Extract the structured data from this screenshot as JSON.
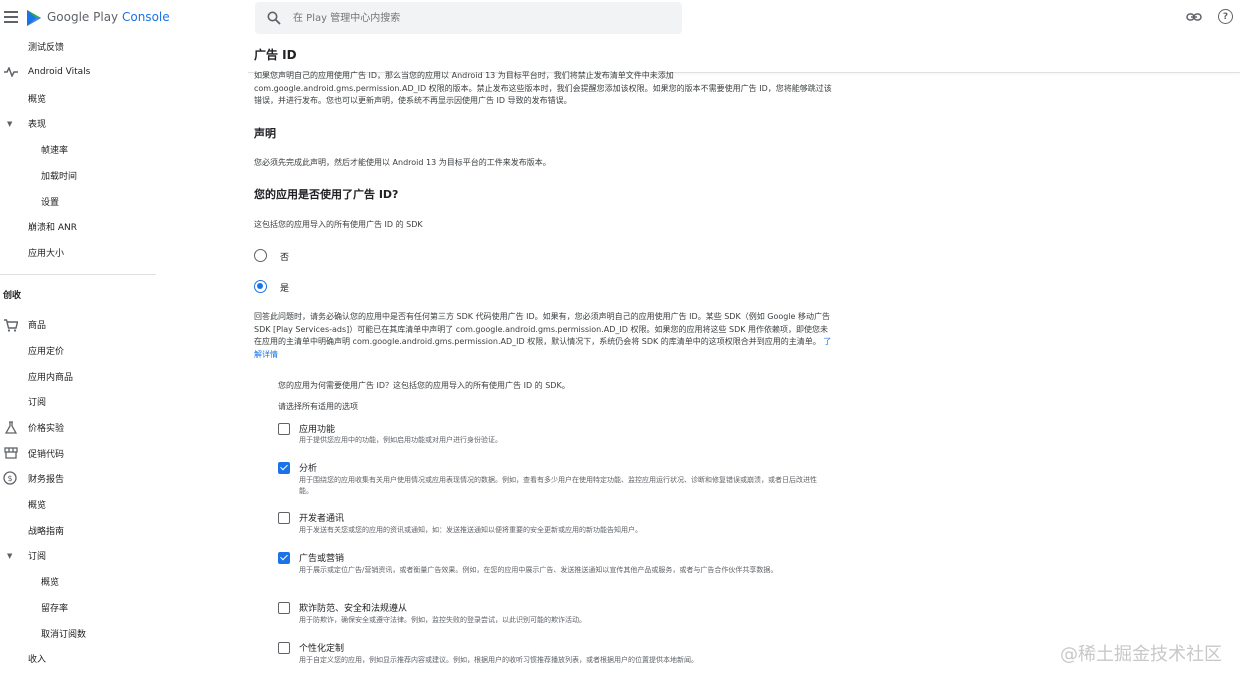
{
  "app": {
    "brand_prefix": "Google Play",
    "brand_suffix": "Console"
  },
  "search": {
    "placeholder": "在 Play 管理中心内搜索"
  },
  "sidebar": {
    "items": [
      {
        "label": "测试反馈"
      },
      {
        "label": "Android Vitals"
      },
      {
        "label": "概览"
      },
      {
        "label": "表现"
      },
      {
        "label": "帧速率"
      },
      {
        "label": "加载时间"
      },
      {
        "label": "设置"
      },
      {
        "label": "崩溃和 ANR"
      },
      {
        "label": "应用大小"
      },
      {
        "label": "创收"
      },
      {
        "label": "商品"
      },
      {
        "label": "应用定价"
      },
      {
        "label": "应用内商品"
      },
      {
        "label": "订阅"
      },
      {
        "label": "价格实验"
      },
      {
        "label": "促销代码"
      },
      {
        "label": "财务报告"
      },
      {
        "label": "概览"
      },
      {
        "label": "战略指南"
      },
      {
        "label": "订阅"
      },
      {
        "label": "概览"
      },
      {
        "label": "留存率"
      },
      {
        "label": "取消订阅数"
      },
      {
        "label": "收入"
      }
    ]
  },
  "main": {
    "title": "广告 ID",
    "intro": "如果您声明自己的应用使用广告 ID，那么当您的应用以 Android 13 为目标平台时，我们将禁止发布清单文件中未添加 com.google.android.gms.permission.AD_ID 权限的版本。禁止发布这些版本时，我们会提醒您添加该权限。如果您的版本不需要使用广告 ID，您将能够跳过该错误，并进行发布。您也可以更新声明，使系统不再显示因使用广告 ID 导致的发布错误。",
    "declaration_heading": "声明",
    "declaration_text": "您必须先完成此声明，然后才能使用以 Android 13 为目标平台的工件来发布版本。",
    "question": "您的应用是否使用了广告 ID?",
    "question_sub": "这包括您的应用导入的所有使用广告 ID 的 SDK",
    "radio_no": "否",
    "radio_yes": "是",
    "explain": "回答此问题时，请务必确认您的应用中是否有任何第三方 SDK 代码使用广告 ID。如果有，您必须声明自己的应用使用广告 ID。某些 SDK（例如 Google 移动广告 SDK [Play Services-ads]）可能已在其库清单中声明了 com.google.android.gms.permission.AD_ID 权限。如果您的应用将这些 SDK 用作依赖项，即使您未在应用的主清单中明确声明 com.google.android.gms.permission.AD_ID 权限，默认情况下，系统仍会将 SDK 的库清单中的这项权限合并到应用的主清单。",
    "learn_more": "了解详情",
    "why_question": "您的应用为何需要使用广告 ID？这包括您的应用导入的所有使用广告 ID 的 SDK。",
    "select_all": "请选择所有适用的选项",
    "options": [
      {
        "title": "应用功能",
        "desc": "用于提供您应用中的功能，例如启用功能或对用户进行身份验证。",
        "checked": false
      },
      {
        "title": "分析",
        "desc": "用于围绕您的应用收集有关用户使用情况或应用表现情况的数据。例如，查看有多少用户在使用特定功能、监控应用运行状况、诊断和修复错误或崩溃，或者日后改进性能。",
        "checked": true
      },
      {
        "title": "开发者通讯",
        "desc": "用于发送有关您或您的应用的资讯或通知，如：发送推送通知以便将重要的安全更新或应用的新功能告知用户。",
        "checked": false
      },
      {
        "title": "广告或营销",
        "desc": "用于展示或定位广告/营销资讯，或者衡量广告效果。例如，在您的应用中展示广告、发送推送通知以宣传其他产品或服务，或者与广告合作伙伴共享数据。",
        "checked": true
      },
      {
        "title": "欺诈防范、安全和法规遵从",
        "desc": "用于防欺诈，确保安全或遵守法律。例如，监控失败的登录尝试，以此识别可能的欺诈活动。",
        "checked": false
      },
      {
        "title": "个性化定制",
        "desc": "用于自定义您的应用，例如显示推荐内容或建议。例如，根据用户的收听习惯推荐播放列表，或者根据用户的位置提供本地新闻。",
        "checked": false
      }
    ]
  },
  "watermark": "@稀土掘金技术社区"
}
